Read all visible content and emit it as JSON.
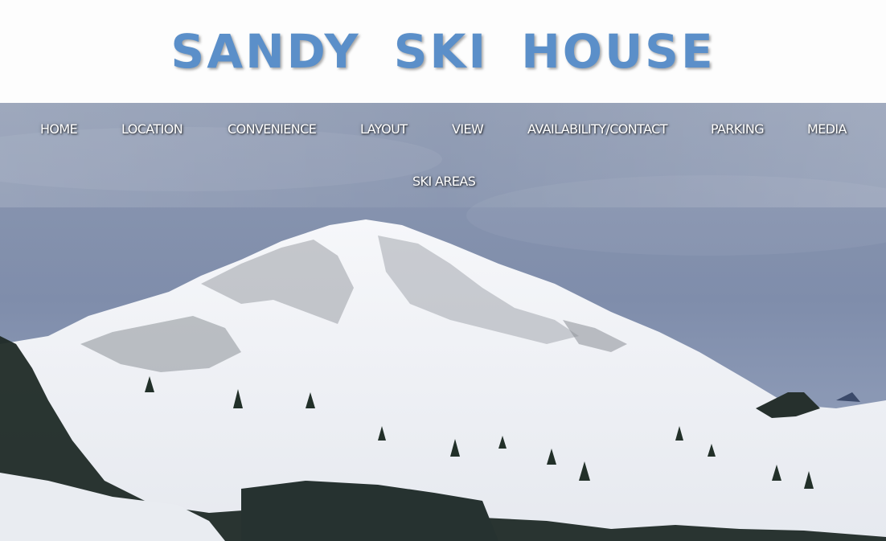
{
  "header": {
    "title": "SANDY  SKI  HOUSE"
  },
  "nav": {
    "items": [
      {
        "label": "HOME"
      },
      {
        "label": "LOCATION"
      },
      {
        "label": "CONVENIENCE"
      },
      {
        "label": "LAYOUT"
      },
      {
        "label": "VIEW"
      },
      {
        "label": "AVAILABILITY/CONTACT"
      },
      {
        "label": "PARKING"
      },
      {
        "label": "MEDIA"
      },
      {
        "label": "SKI AREAS"
      }
    ]
  },
  "colors": {
    "title": "#5b8fc9",
    "nav_text": "#ffffff",
    "sky": "#8894ac",
    "snow": "#f4f5f8",
    "trees": "#1f2a26"
  }
}
